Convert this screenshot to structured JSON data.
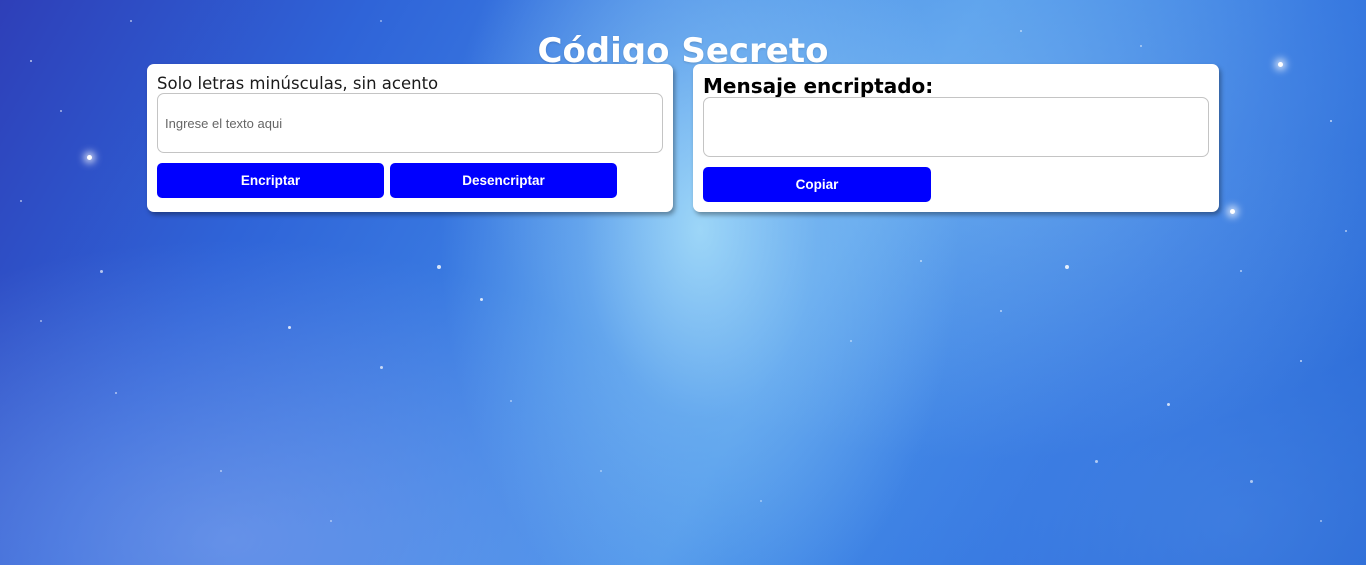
{
  "header": {
    "title": "Código Secreto"
  },
  "input_panel": {
    "hint": "Solo letras minúsculas, sin acento",
    "placeholder": "Ingrese el texto aqui",
    "encrypt_label": "Encriptar",
    "decrypt_label": "Desencriptar"
  },
  "output_panel": {
    "label": "Mensaje encriptado:",
    "value": "",
    "copy_label": "Copiar"
  },
  "colors": {
    "button": "#0000ff",
    "card": "#ffffff",
    "title": "#ffffff"
  }
}
